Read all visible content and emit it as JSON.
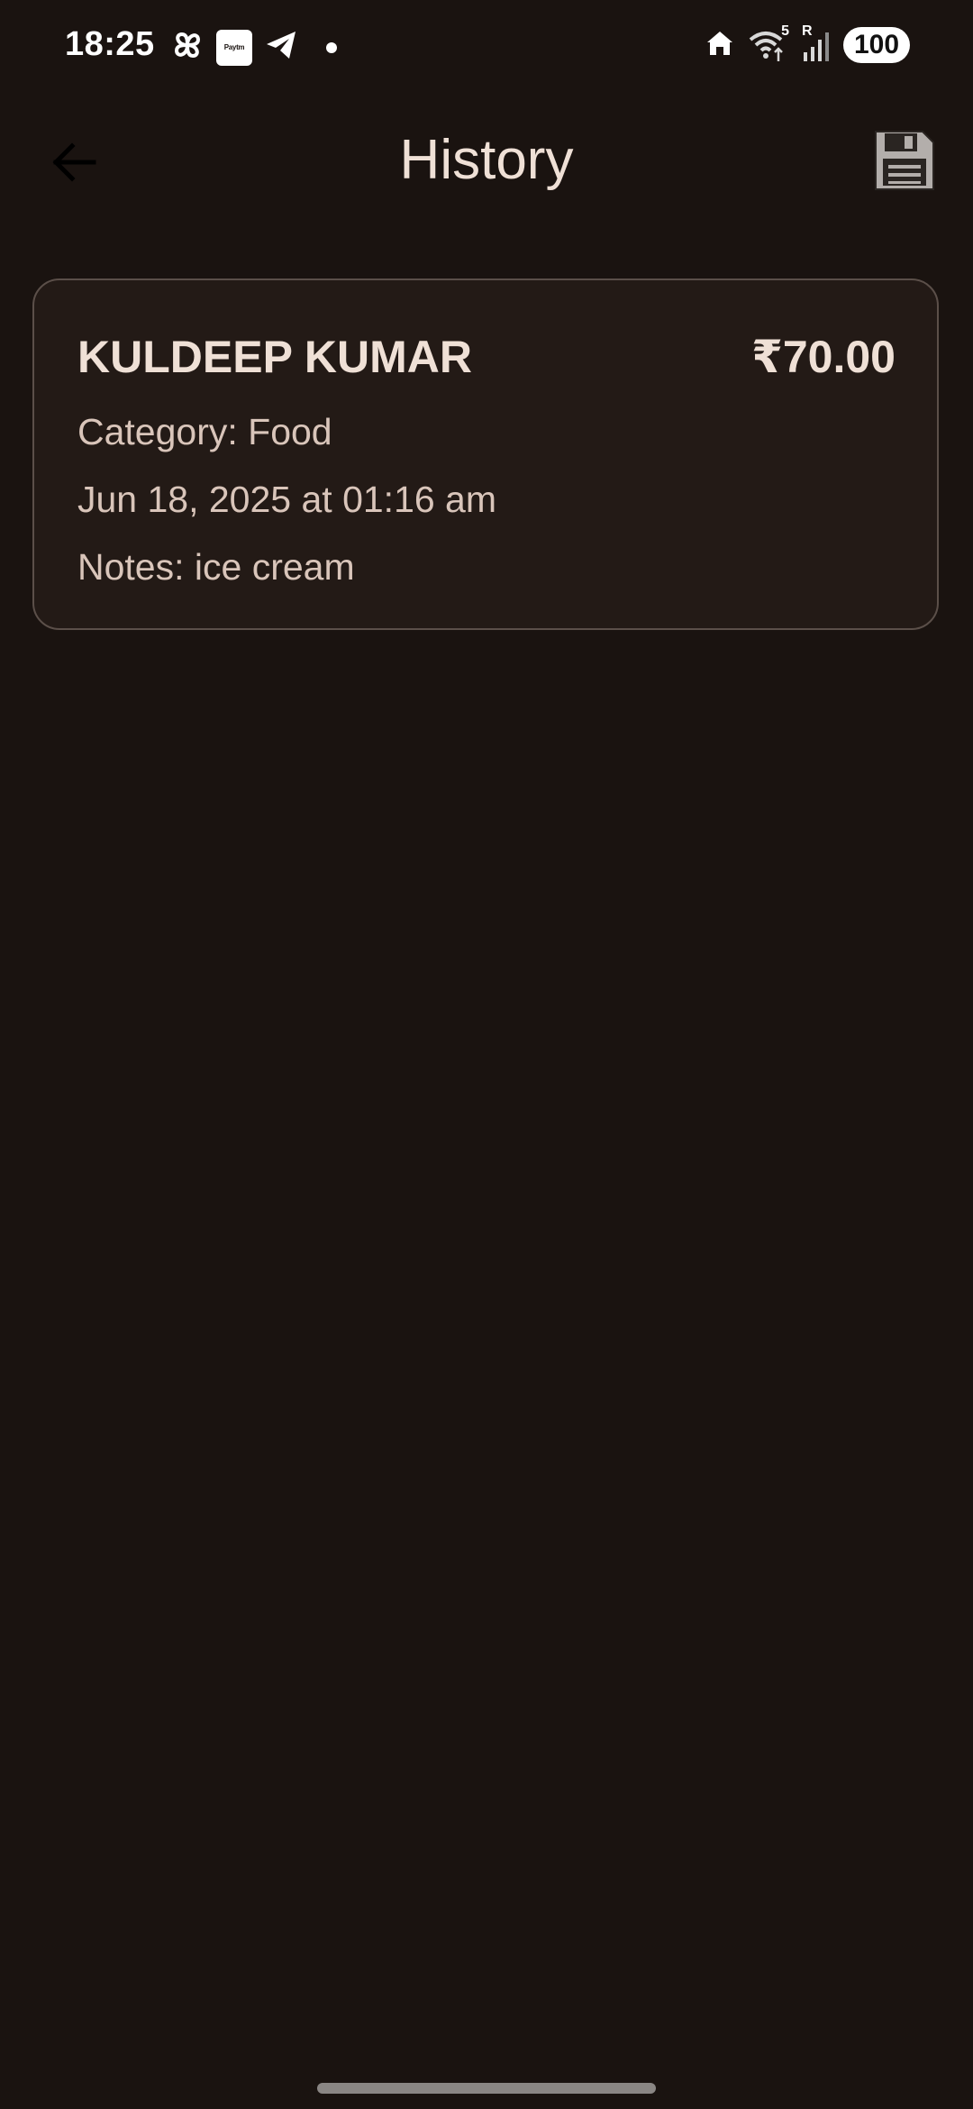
{
  "status_bar": {
    "time": "18:25",
    "paytm_label": "Paytm",
    "network_label": "5",
    "roaming_label": "R",
    "battery": "100"
  },
  "app_bar": {
    "title": "History",
    "back_icon": "arrow-back-icon",
    "save_icon": "floppy-disk-icon"
  },
  "history": {
    "items": [
      {
        "name": "KULDEEP KUMAR",
        "amount": "₹70.00",
        "category": "Category: Food",
        "datetime": "Jun 18, 2025 at 01:16 am",
        "notes": "Notes: ice cream"
      }
    ]
  },
  "colors": {
    "background": "#1a1310",
    "card_background": "#231a16",
    "card_border": "#5b4f49",
    "text_primary": "#efe0d6",
    "text_secondary": "#d9c5ba"
  }
}
